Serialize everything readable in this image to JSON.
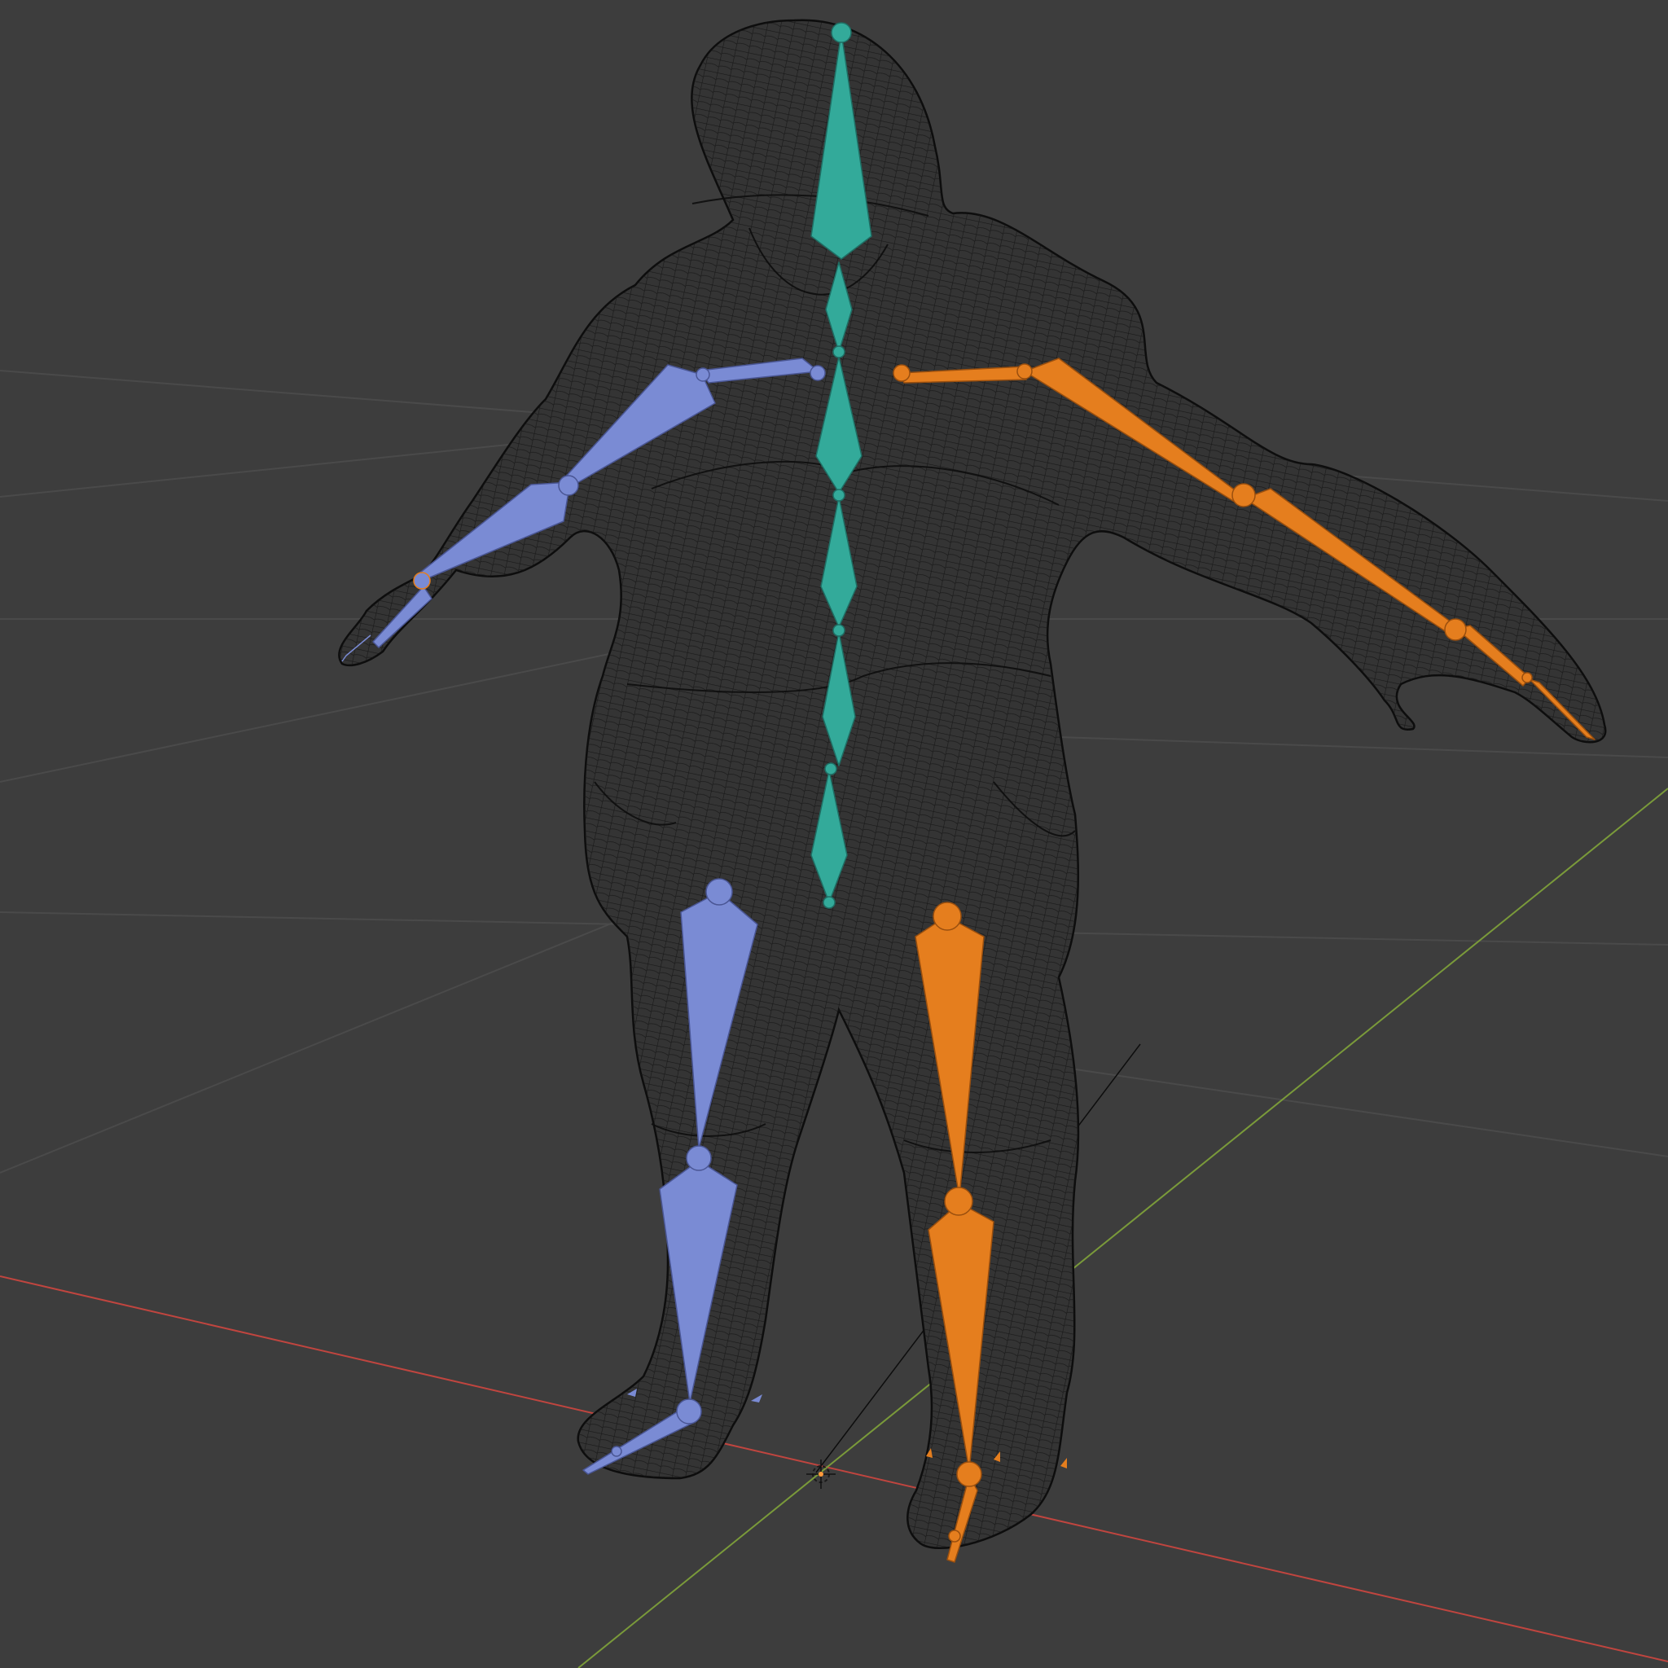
{
  "viewport": {
    "background_color": "#3d3d3d",
    "grid_color": "#4a4a4a",
    "x_axis_color": "#c0453f",
    "y_axis_color": "#7a9a3a",
    "wireframe_color": "#0d0d0d",
    "object_origin_color": "#ff9a3c"
  },
  "armature": {
    "center_bone_color": "#33aa9a",
    "left_bone_color": "#7a8bd4",
    "right_bone_color": "#e57e1e",
    "bone_groups": [
      "spine",
      "left_arm",
      "right_arm",
      "left_leg",
      "right_leg"
    ]
  },
  "icons": {
    "origin": "origin-cursor-icon"
  }
}
